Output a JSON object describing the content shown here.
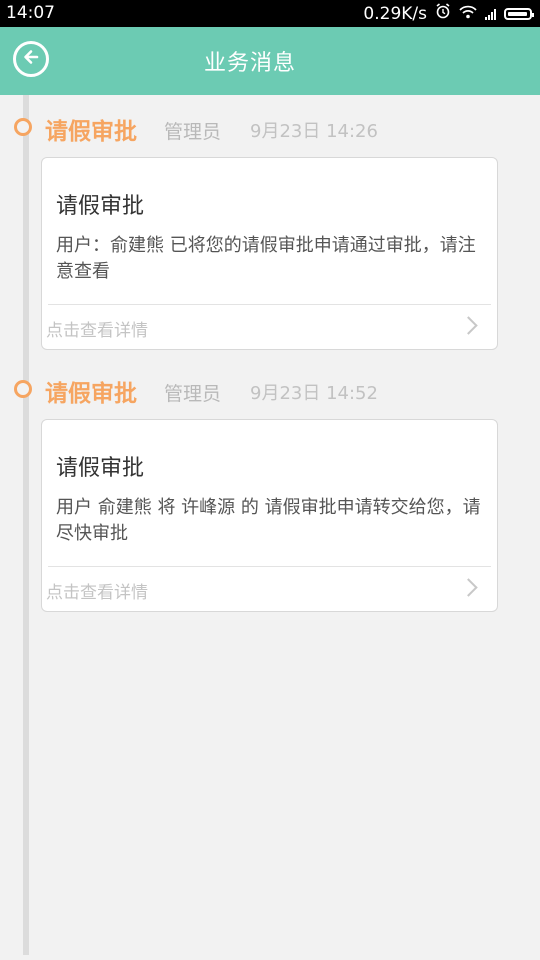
{
  "status_bar": {
    "time": "14:07",
    "net_speed": "0.29K/s",
    "icons": [
      "alarm-icon",
      "wifi-icon",
      "signal-icon",
      "battery-icon"
    ]
  },
  "header": {
    "title": "业务消息",
    "back_icon": "back-arrow-icon",
    "color": "#6ccbb3"
  },
  "messages": [
    {
      "type": "请假审批",
      "sender": "管理员",
      "time": "9月23日 14:26",
      "title": "请假审批",
      "body": "用户：俞建熊 已将您的请假审批申请通过审批，请注意查看",
      "link": "点击查看详情"
    },
    {
      "type": "请假审批",
      "sender": "管理员",
      "time": "9月23日 14:52",
      "title": "请假审批",
      "body": "用户 俞建熊 将 许峰源 的 请假审批申请转交给您，请尽快审批",
      "link": "点击查看详情"
    }
  ],
  "colors": {
    "accent": "#f6a561",
    "header": "#6ccbb3"
  }
}
